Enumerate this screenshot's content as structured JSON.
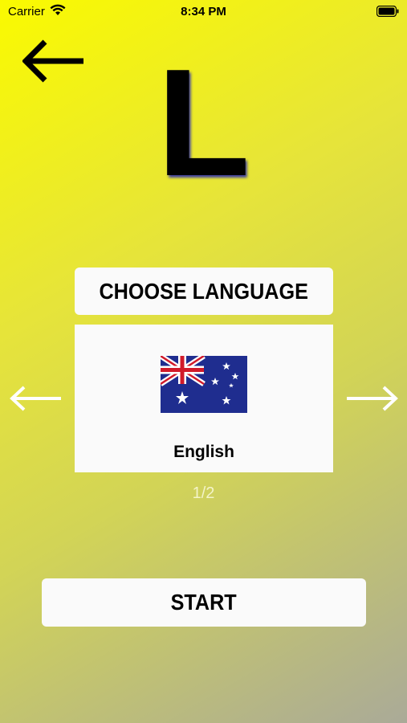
{
  "status_bar": {
    "carrier": "Carrier",
    "time": "8:34 PM"
  },
  "letter": "L",
  "language_picker": {
    "title": "CHOOSE LANGUAGE",
    "language_name": "English",
    "flag": "australia-flag",
    "page_indicator": "1/2"
  },
  "start_label": "START",
  "colors": {
    "background_top": "#fafa00",
    "background_bottom": "#aaaa98",
    "panel": "#fafafa"
  }
}
